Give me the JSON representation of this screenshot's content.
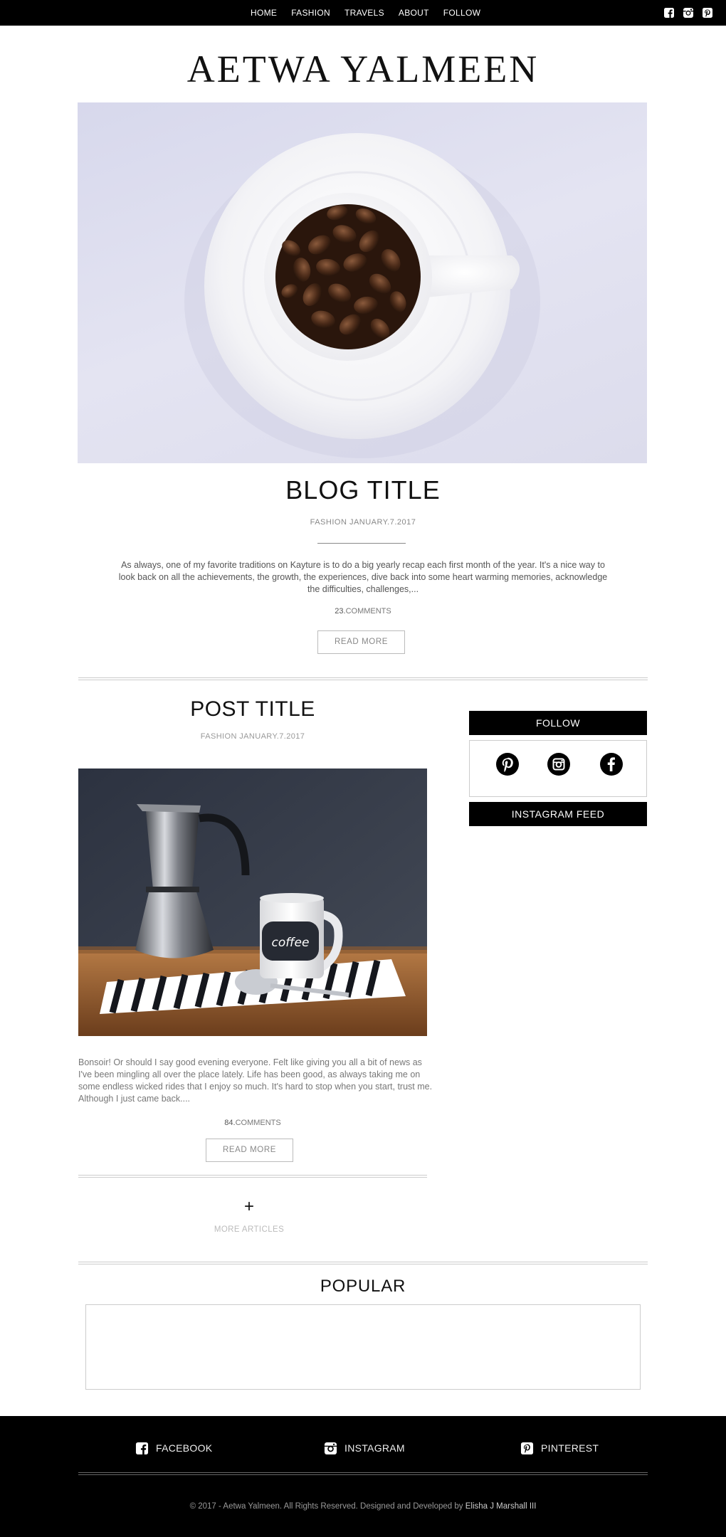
{
  "nav": {
    "links": [
      "HOME",
      "FASHION",
      "TRAVELS",
      "ABOUT",
      "FOLLOW"
    ],
    "social_icons": [
      "facebook-icon",
      "instagram-icon",
      "pinterest-icon"
    ]
  },
  "brand": {
    "title": "AETWA YALMEEN"
  },
  "featured": {
    "title": "BLOG TITLE",
    "meta": "FASHION  JANUARY.7.2017",
    "excerpt": "As always, one of my favorite traditions on Kayture is to do a big yearly recap each first month of the year. It's a nice way to look back on all the achievements, the growth, the experiences, dive back into some heart warming memories, acknowledge the difficulties, challenges,...",
    "comments_count": "23.",
    "comments_label": "COMMENTS",
    "read_more": "READ MORE"
  },
  "post": {
    "title": "POST TITLE",
    "meta": "FASHION  JANUARY.7.2017",
    "excerpt": "Bonsoir! Or should I say good evening everyone. Felt like giving you all a bit of news as I've been mingling all over the place lately. Life has been good, as always taking me on some endless wicked rides that I enjoy so much. It's hard to stop when you start, trust me. Although I just came back....",
    "comments_count": "84.",
    "comments_label": "COMMENTS",
    "read_more": "READ MORE",
    "mug_text": "coffee"
  },
  "more": {
    "plus": "+",
    "label": "MORE ARTICLES"
  },
  "sidebar": {
    "follow_label": "FOLLOW",
    "follow_icons": [
      "pinterest-icon",
      "instagram-icon",
      "facebook-icon"
    ],
    "instagram_label": "INSTAGRAM FEED"
  },
  "popular": {
    "title": "POPULAR"
  },
  "footer": {
    "facebook": "FACEBOOK",
    "instagram": "INSTAGRAM",
    "pinterest": "PINTEREST",
    "copyright": "© 2017 - Aetwa Yalmeen. All Rights Reserved. Designed and Developed by ",
    "author": "Elisha J Marshall III"
  },
  "colors": {
    "bar": "#000000",
    "text": "#111111",
    "muted": "#888888",
    "rule": "#cccccc"
  }
}
